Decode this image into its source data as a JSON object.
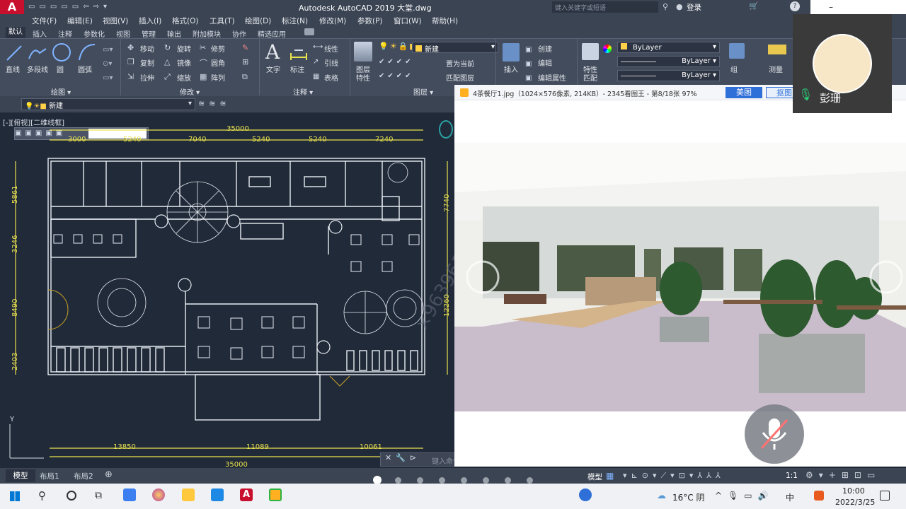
{
  "window": {
    "title": "Autodesk AutoCAD 2019   大堂.dwg",
    "search_placeholder": "键入关键字或短语",
    "login_label": "登录"
  },
  "menu": [
    "文件(F)",
    "编辑(E)",
    "视图(V)",
    "插入(I)",
    "格式(O)",
    "工具(T)",
    "绘图(D)",
    "标注(N)",
    "修改(M)",
    "参数(P)",
    "窗口(W)",
    "帮助(H)"
  ],
  "ribbon_tabs": [
    "默认",
    "插入",
    "注释",
    "参数化",
    "视图",
    "管理",
    "输出",
    "附加模块",
    "协作",
    "精选应用"
  ],
  "ribbon": {
    "draw_tools": [
      "直线",
      "多段线",
      "圆",
      "圆弧"
    ],
    "draw_panel": "绘图 ▾",
    "modify_tools": [
      "移动",
      "旋转",
      "修剪",
      "复制",
      "镜像",
      "圆角",
      "拉伸",
      "缩放",
      "阵列"
    ],
    "modify_panel": "修改 ▾",
    "annot_tools": [
      "文字",
      "标注",
      "线性",
      "引线",
      "表格"
    ],
    "annot_panel": "注释 ▾",
    "layer_tools": [
      "图层",
      "特性",
      "置为当前",
      "匹配图层"
    ],
    "layer_name": "新建",
    "layer_panel": "图层 ▾",
    "block_tools": [
      "插入",
      "创建",
      "编辑",
      "编辑属性"
    ],
    "prop_tools": [
      "特性",
      "匹配"
    ],
    "bylayer": [
      "ByLayer",
      "ByLayer",
      "ByLayer"
    ],
    "group_label": "组",
    "measure_label": "测量"
  },
  "layer_dropdown": "新建",
  "view_label": "[-][俯视][二维线框]",
  "dims": {
    "top_total": "35000",
    "top_segs": [
      "3000",
      "5240",
      "7040",
      "5240",
      "5240",
      "7240"
    ],
    "left_segs": [
      "5861",
      "3246",
      "8490",
      "2403"
    ],
    "right_segs": [
      "7740",
      "12260"
    ],
    "bottom_segs": [
      "13850",
      "11089",
      "10061"
    ],
    "bottom_total": "35000"
  },
  "viewer": {
    "title": "4茶餐厅1.jpg（1024×576像素, 214KB）- 2345看图王 - 第8/18张 97%",
    "btn1": "美图",
    "btn2": "抠图"
  },
  "participant": {
    "name": "彭珊"
  },
  "command_placeholder": "键入命令",
  "layout_tabs": [
    "模型",
    "布局1",
    "布局2"
  ],
  "status_model": "模型",
  "scale": "1:1",
  "carousel": {
    "count": 8,
    "active": 0
  },
  "taskbar": {
    "weather": "16°C 阴",
    "ime": "中",
    "time": "10:00",
    "date": "2022/3/25"
  },
  "colors": {
    "accent": "#e9e24f",
    "brand_red": "#c8102e",
    "viewer_btn": "#2f6fd8"
  }
}
